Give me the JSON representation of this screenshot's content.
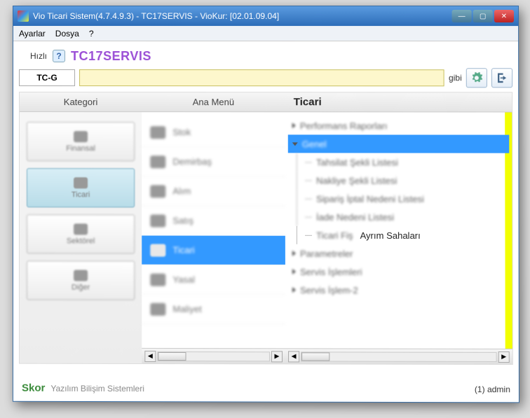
{
  "window": {
    "title": "Vio Ticari Sistem(4.7.4.9.3)  - TC17SERVIS - VioKur: [02.01.09.04]"
  },
  "menubar": {
    "items": [
      "Ayarlar",
      "Dosya",
      "?"
    ]
  },
  "toolbar": {
    "quick_label": "Hızlı",
    "service_name": "TC17SERVIS",
    "tcg": "TC-G",
    "search_value": "",
    "gibi": "gibi"
  },
  "columns": {
    "kategori": {
      "header": "Kategori",
      "items": [
        "Finansal",
        "Ticari",
        "Sektörel",
        "Diğer"
      ],
      "active": 1
    },
    "anamenu": {
      "header": "Ana Menü",
      "items": [
        "Stok",
        "Demirbaş",
        "Alım",
        "Satış",
        "Ticari",
        "Yasal",
        "Maliyet"
      ],
      "active": 4
    },
    "ticari": {
      "header": "Ticari",
      "tree": [
        {
          "label": "Performans Raporları",
          "type": "node"
        },
        {
          "label": "Genel",
          "type": "node",
          "selected": true,
          "expanded": true
        },
        {
          "label": "Tahsilat Şekli Listesi",
          "type": "child"
        },
        {
          "label": "Nakliye Şekli Listesi",
          "type": "child"
        },
        {
          "label": "Sipariş İptal Nedeni Listesi",
          "type": "child"
        },
        {
          "label": "İade Nedeni Listesi",
          "type": "child"
        },
        {
          "label_prefix": "Ticari Fiş",
          "label_clear": "Ayrım Sahaları",
          "type": "child",
          "clear": true
        },
        {
          "label": "Parametreler",
          "type": "node"
        },
        {
          "label": "Servis İşlemleri",
          "type": "node"
        },
        {
          "label": "Servis İşlem-2",
          "type": "node"
        }
      ]
    }
  },
  "footer": {
    "brand": "Skor",
    "company": "Yazılım Bilişim Sistemleri",
    "user": "(1) admin"
  }
}
